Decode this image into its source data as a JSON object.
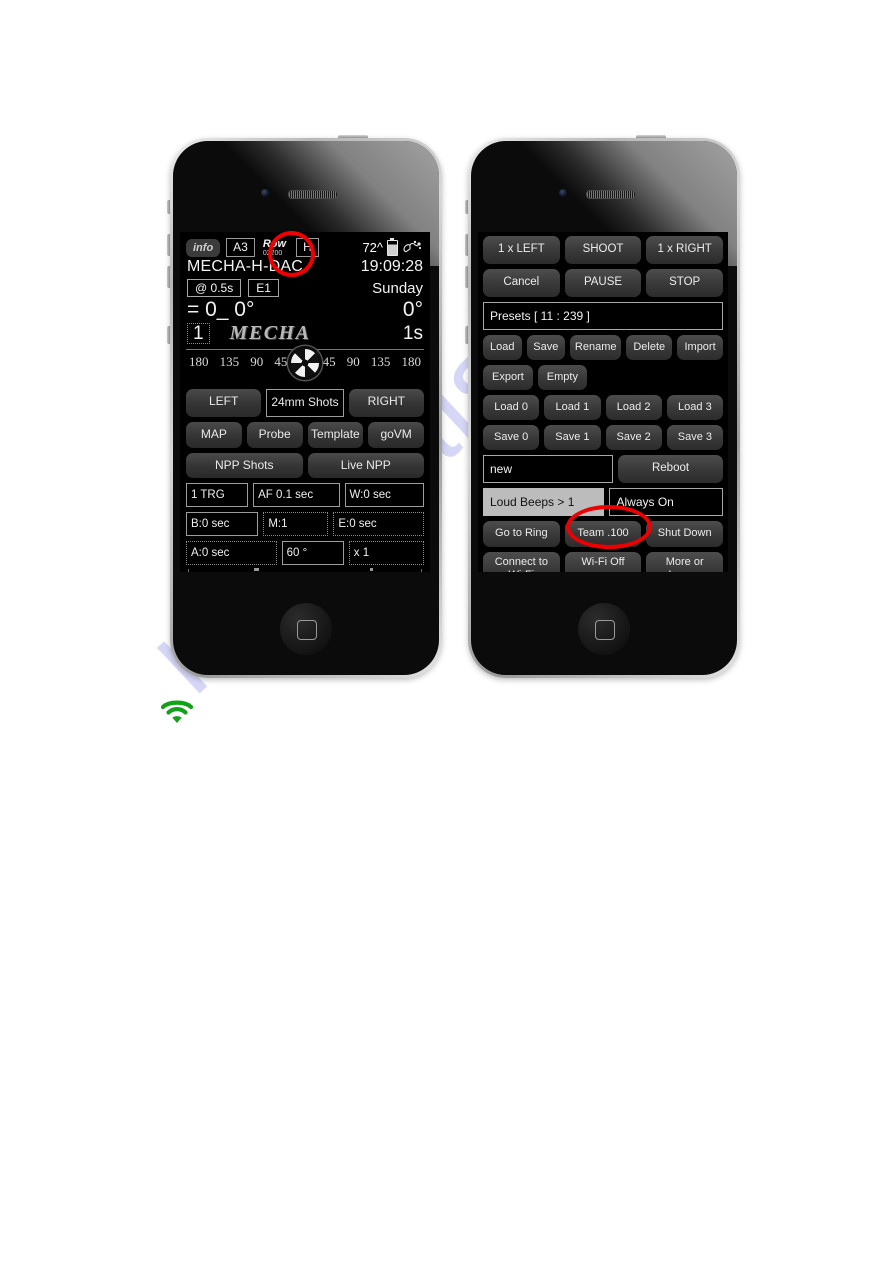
{
  "page": {
    "watermark": "manualslib",
    "background_color": "#ffffff",
    "annotation_color": "#ee0000"
  },
  "wifi_indicator": {
    "icon": "wifi-icon",
    "color": "#14a01a"
  },
  "left_phone": {
    "device": "smartphone",
    "screen": {
      "header": {
        "info_button": "info",
        "channel_button": "A3",
        "row_label": "Row",
        "row_value": "02200",
        "mode_button": "H",
        "battery_value": "72^",
        "battery_icon": "battery-icon",
        "gesture_icon": "hand-tap-icon"
      },
      "title": "MECHA-H-DAC",
      "clock": "19:09:28",
      "delay_pill": "@ 0.5s",
      "e_pill": "E1",
      "weekday": "Sunday",
      "angle_left": "= 0_ 0°",
      "angle_right": "0°",
      "count_box": "1",
      "logo": "MECHA",
      "duration": "1s",
      "dial_ticks": [
        "180",
        "135",
        "90",
        "45",
        "45",
        "90",
        "135",
        "180"
      ],
      "dial_icon": "compass-rosette-icon",
      "row_main": [
        "LEFT",
        "24mm Shots",
        "RIGHT"
      ],
      "row_tools": [
        "MAP",
        "Probe",
        "Template",
        "goVM"
      ],
      "row_npp": [
        "NPP Shots",
        "Live NPP"
      ],
      "row_fields_1": [
        "1 TRG",
        "AF 0.1 sec",
        "W:0 sec"
      ],
      "row_fields_2": [
        "B:0 sec",
        "M:1",
        "E:0 sec"
      ],
      "row_fields_3": [
        "A:0 sec",
        "60 °",
        "x 1"
      ]
    }
  },
  "right_phone": {
    "device": "smartphone",
    "screen": {
      "row_actions": [
        "1 x LEFT",
        "SHOOT",
        "1 x RIGHT"
      ],
      "row_transport": [
        "Cancel",
        "PAUSE",
        "STOP"
      ],
      "presets_field": "Presets [ 11 : 239 ]",
      "row_preset_ops": [
        "Load",
        "Save",
        "Rename",
        "Delete",
        "Import"
      ],
      "row_preset_ops2": [
        "Export",
        "Empty"
      ],
      "row_load": [
        "Load 0",
        "Load 1",
        "Load 2",
        "Load 3"
      ],
      "row_save": [
        "Save 0",
        "Save 1",
        "Save 2",
        "Save 3"
      ],
      "name_field": "new",
      "reboot_button": "Reboot",
      "beeps_field": "Loud Beeps > 1",
      "always_on_field": "Always On",
      "row_system": [
        "Go to Ring",
        "Team .100",
        "Shut Down"
      ],
      "row_wifi": [
        "Connect to Wi-Fi",
        "Wi-Fi Off",
        "More or Less..."
      ]
    }
  }
}
